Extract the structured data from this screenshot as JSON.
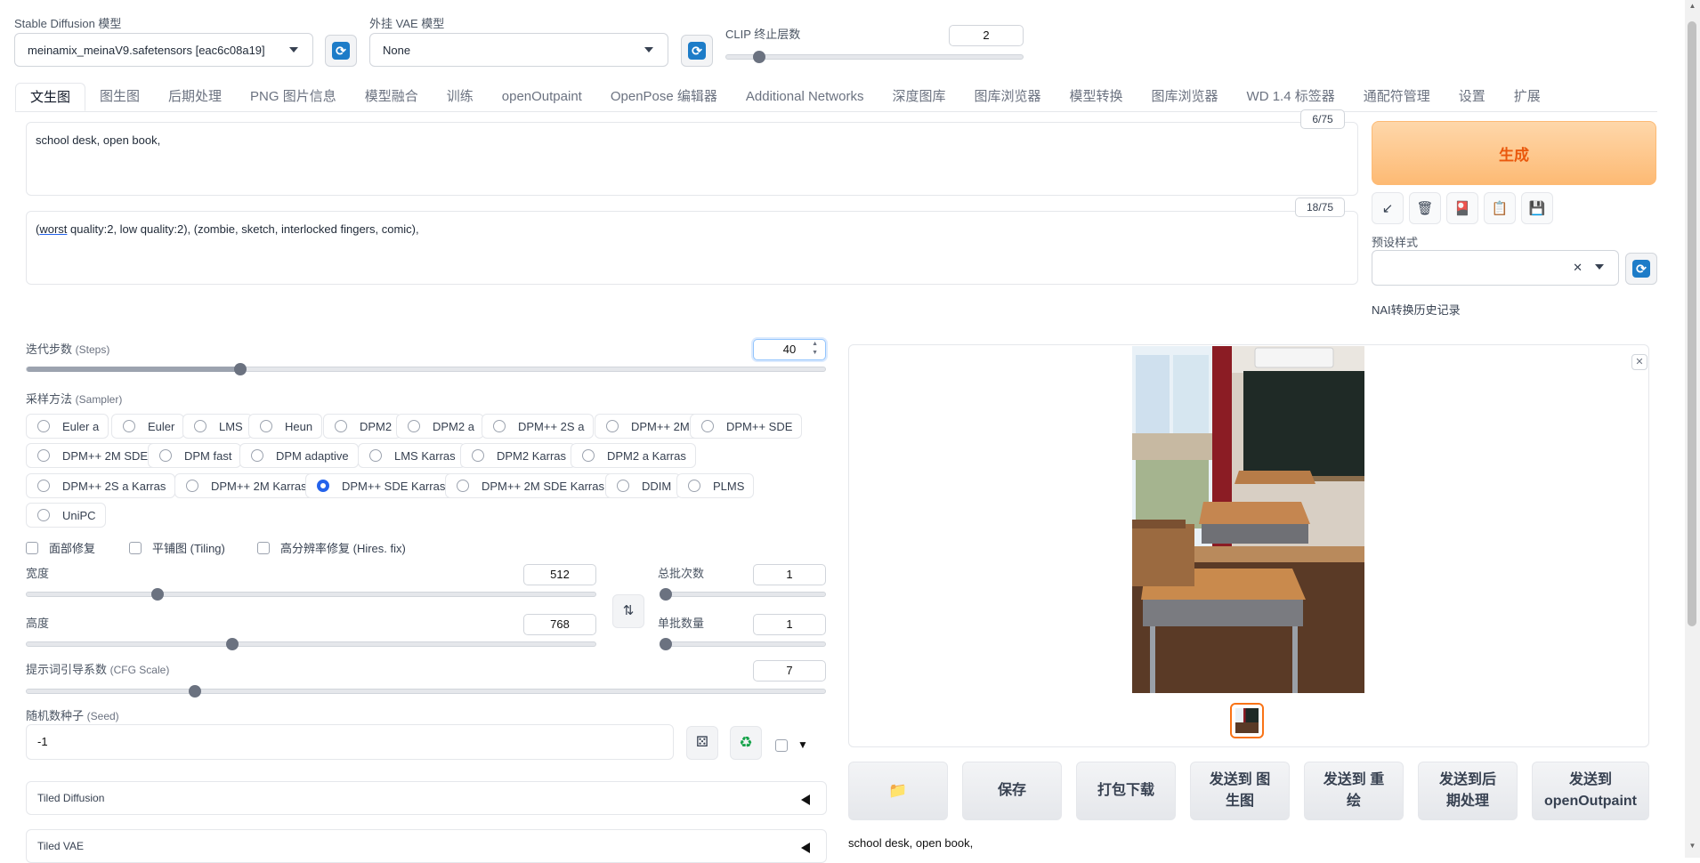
{
  "top": {
    "sd_model_label": "Stable Diffusion 模型",
    "sd_model_value": "meinamix_meinaV9.safetensors [eac6c08a19]",
    "vae_label": "外挂 VAE 模型",
    "vae_value": "None",
    "clip_label": "CLIP 终止层数",
    "clip_value": "2"
  },
  "tabs": [
    "文生图",
    "图生图",
    "后期处理",
    "PNG 图片信息",
    "模型融合",
    "训练",
    "openOutpaint",
    "OpenPose 编辑器",
    "Additional Networks",
    "深度图库",
    "图库浏览器",
    "模型转换",
    "图库浏览器",
    "WD 1.4 标签器",
    "通配符管理",
    "设置",
    "扩展"
  ],
  "prompt": {
    "positive": "school desk, open book,",
    "positive_count": "6/75",
    "negative_lead": "(",
    "negative_underlined": "worst",
    "negative_rest": " quality:2, low quality:2), (zombie, sketch, interlocked fingers, comic),",
    "negative_count": "18/75"
  },
  "right": {
    "generate_label": "生成",
    "styles_label": "预设样式",
    "nai_label": "NAI转换历史记录",
    "tool_icons": [
      "arrow-icon",
      "trash-icon",
      "card-icon",
      "clipboard-icon",
      "save-icon"
    ],
    "tool_glyphs": [
      "↙",
      "🗑",
      "🎴",
      "📋",
      "💾"
    ]
  },
  "steps": {
    "label": "迭代步数",
    "label_en": "(Steps)",
    "value": "40",
    "fraction": 0.267
  },
  "sampler": {
    "label": "采样方法",
    "label_en": "(Sampler)",
    "selected": "DPM++ SDE Karras",
    "options": [
      "Euler a",
      "Euler",
      "LMS",
      "Heun",
      "DPM2",
      "DPM2 a",
      "DPM++ 2S a",
      "DPM++ 2M",
      "DPM++ SDE",
      "DPM++ 2M SDE",
      "DPM fast",
      "DPM adaptive",
      "LMS Karras",
      "DPM2 Karras",
      "DPM2 a Karras",
      "DPM++ 2S a Karras",
      "DPM++ 2M Karras",
      "DPM++ SDE Karras",
      "DPM++ 2M SDE Karras",
      "DDIM",
      "PLMS",
      "UniPC"
    ]
  },
  "checks": {
    "face": "面部修复",
    "tiling": "平铺图 (Tiling)",
    "hires": "高分辨率修复 (Hires. fix)"
  },
  "width": {
    "label": "宽度",
    "value": "512",
    "fraction": 0.23
  },
  "height": {
    "label": "高度",
    "value": "768",
    "fraction": 0.36
  },
  "batch_count": {
    "label": "总批次数",
    "value": "1",
    "fraction": 0.0
  },
  "batch_size": {
    "label": "单批数量",
    "value": "1",
    "fraction": 0.0
  },
  "cfg": {
    "label": "提示词引导系数",
    "label_en": "(CFG Scale)",
    "value": "7",
    "fraction": 0.21
  },
  "seed": {
    "label": "随机数种子",
    "label_en": "(Seed)",
    "value": "-1"
  },
  "accordions": {
    "tiled_diffusion": "Tiled Diffusion",
    "tiled_vae": "Tiled VAE"
  },
  "actions": {
    "folder_icon": "folder-icon",
    "save": "保存",
    "zip": "打包下载",
    "to_img2img": "发送到 图生图",
    "to_inpaint": "发送到 重绘",
    "to_extras": "发送到后期处理",
    "to_outpaint": "发送到 openOutpaint"
  },
  "output_caption": "school desk, open book,"
}
